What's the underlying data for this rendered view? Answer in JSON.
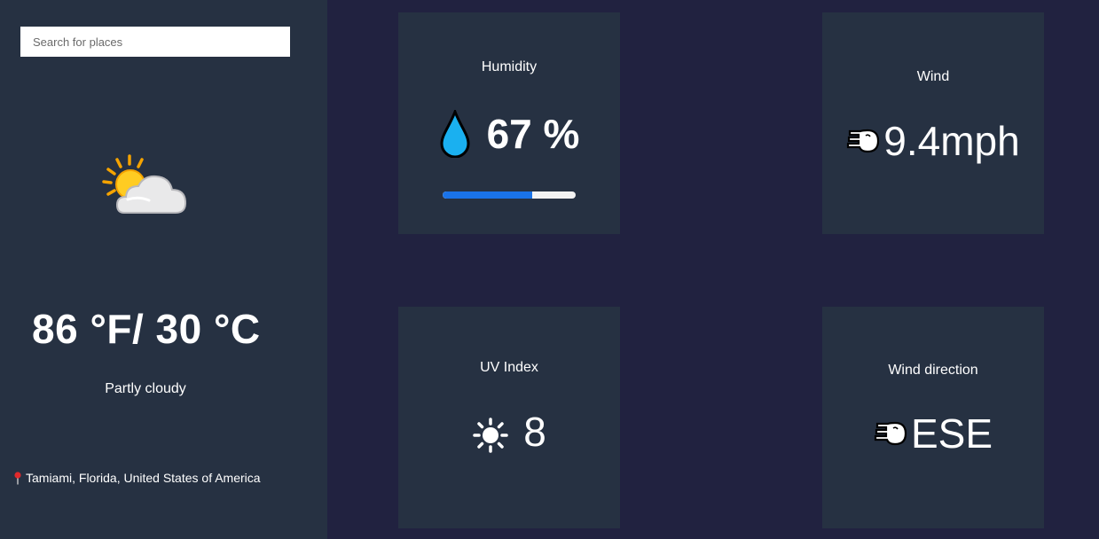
{
  "search": {
    "placeholder": "Search for places",
    "value": ""
  },
  "current": {
    "icon": "partly-cloudy-icon",
    "temperature": "86 °F/ 30 °C",
    "condition": "Partly cloudy",
    "location": "Tamiami, Florida, United States of America"
  },
  "cards": {
    "humidity": {
      "title": "Humidity",
      "value": "67 %",
      "percent": 67,
      "icon": "water-drop-icon"
    },
    "wind": {
      "title": "Wind",
      "value": "9.4mph",
      "icon": "wind-face-icon"
    },
    "uv": {
      "title": "UV Index",
      "value": "8",
      "icon": "sun-icon"
    },
    "wind_direction": {
      "title": "Wind direction",
      "value": "ESE",
      "icon": "wind-face-icon"
    }
  },
  "colors": {
    "sidebar": "#263142",
    "background": "#212240",
    "card": "#263142",
    "accent": "#1a73e8",
    "drop": "#1ab0f0"
  }
}
